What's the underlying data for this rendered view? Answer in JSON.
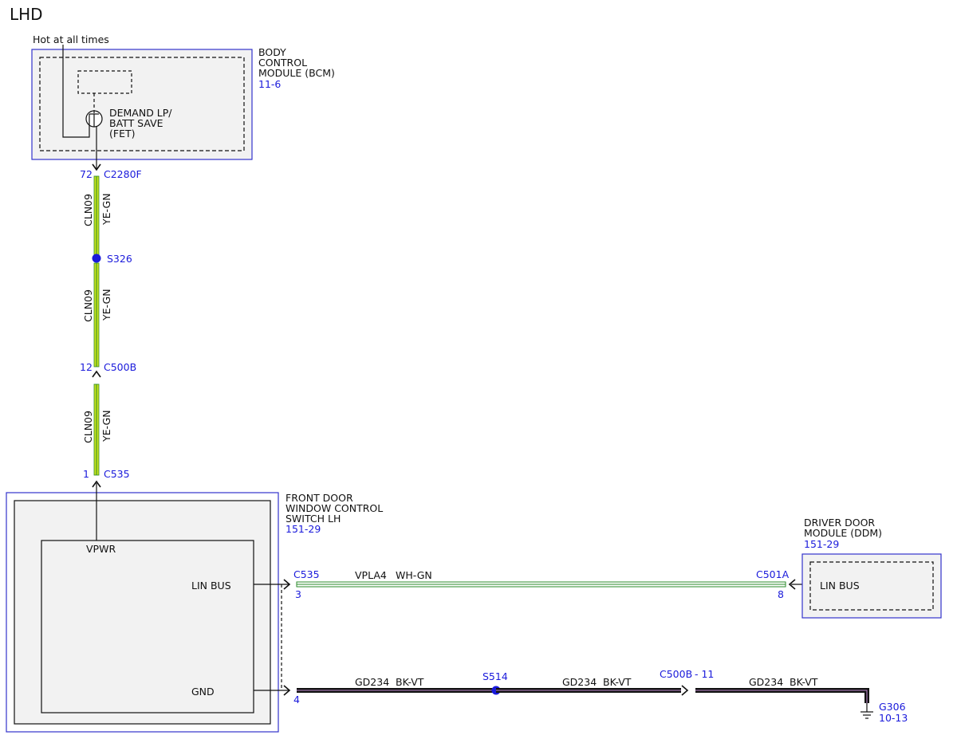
{
  "page_title": "LHD",
  "colors": {
    "module_border": "#3333cc",
    "module_fill": "#f2f2f2",
    "ref_text": "#1a1adb",
    "splice_dot": "#1a1adb",
    "wire_ye_gn_fill": "#c9e21a",
    "wire_ye_gn_stripe": "#2a8a2a",
    "wire_wh_gn_fill": "#ffffff",
    "wire_wh_gn_stripe": "#2a8a2a",
    "wire_bk_vt_fill": "#111111",
    "wire_bk_vt_stripe": "#c08ad0"
  },
  "power": {
    "label": "Hot at all times"
  },
  "bcm": {
    "name_lines": [
      "BODY",
      "CONTROL",
      "MODULE (BCM)"
    ],
    "ref": "11-6",
    "internal_lines": [
      "DEMAND LP/",
      "BATT SAVE",
      "(FET)"
    ]
  },
  "connectors": {
    "c2280f": {
      "pin": "72",
      "name": "C2280F"
    },
    "c500b_top": {
      "pin": "12",
      "name": "C500B"
    },
    "c535_top": {
      "pin": "1",
      "name": "C535"
    },
    "c535_lin": {
      "name": "C535",
      "pin": "3"
    },
    "c535_gnd": {
      "pin": "4"
    },
    "c501a": {
      "name": "C501A",
      "pin": "8"
    },
    "c500b_gnd": {
      "name": "C500B",
      "pin": "- 11"
    }
  },
  "splices": {
    "s326": "S326",
    "s514": "S514"
  },
  "wires": {
    "seg1": {
      "circuit": "CLN09",
      "color": "YE-GN"
    },
    "seg2": {
      "circuit": "CLN09",
      "color": "YE-GN"
    },
    "seg3": {
      "circuit": "CLN09",
      "color": "YE-GN"
    },
    "lin": {
      "circuit": "VPLA4",
      "color": "WH-GN"
    },
    "gnd1": {
      "circuit": "GD234",
      "color": "BK-VT"
    },
    "gnd2": {
      "circuit": "GD234",
      "color": "BK-VT"
    },
    "gnd3": {
      "circuit": "GD234",
      "color": "BK-VT"
    }
  },
  "fdwcs": {
    "name_lines": [
      "FRONT DOOR",
      "WINDOW CONTROL",
      "SWITCH LH"
    ],
    "ref": "151-29",
    "vpwr": "VPWR",
    "lin_bus": "LIN BUS",
    "gnd": "GND"
  },
  "ddm": {
    "name_lines": [
      "DRIVER DOOR",
      "MODULE (DDM)"
    ],
    "ref": "151-29",
    "lin_bus": "LIN BUS"
  },
  "ground": {
    "name": "G306",
    "ref": "10-13"
  }
}
